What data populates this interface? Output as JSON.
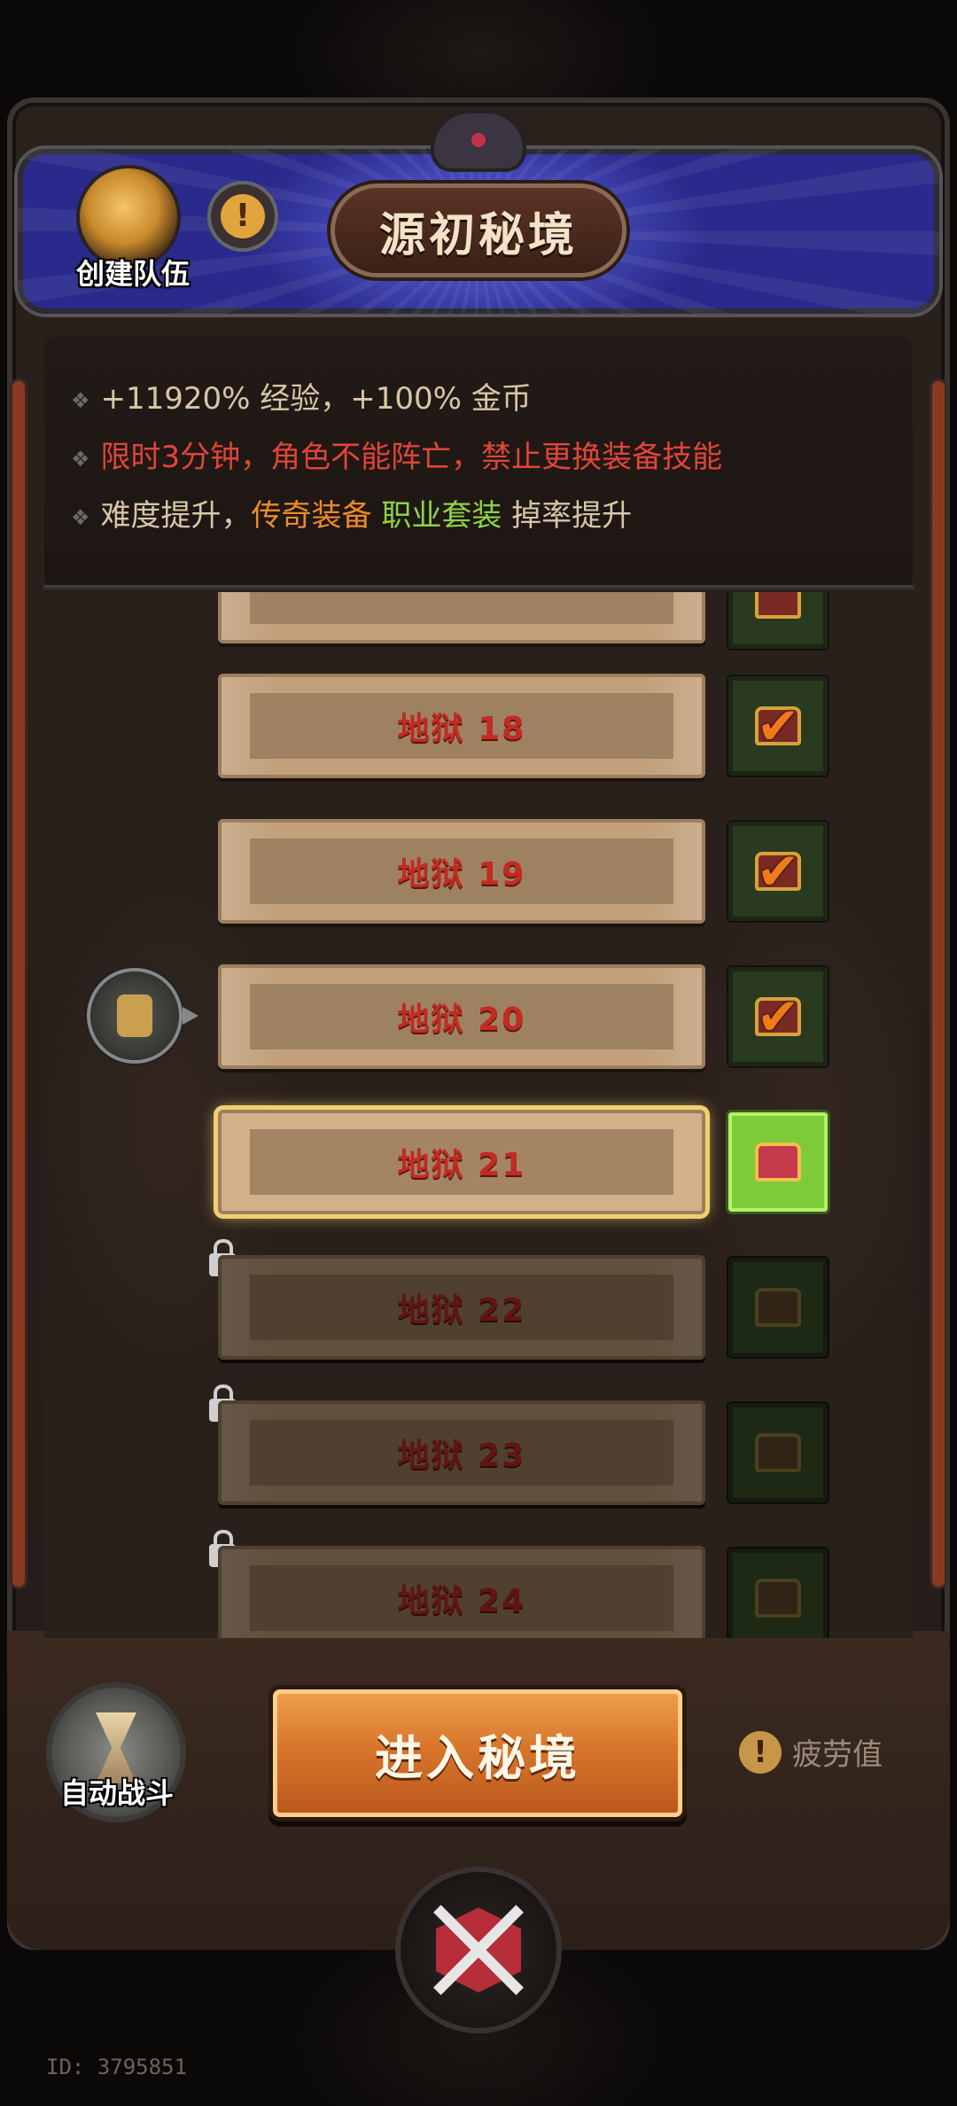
{
  "header": {
    "title": "源初秘境",
    "create_team_label": "创建队伍",
    "info_icon": "exclamation-icon"
  },
  "info": {
    "line1": "+11920% 经验，+100% 金币",
    "line2": "限时3分钟，角色不能阵亡，禁止更换装备技能",
    "line3_prefix": "难度提升，",
    "line3_legendary": "传奇装备",
    "line3_set": "职业套装",
    "line3_suffix": "掉率提升",
    "bullet": "❖"
  },
  "levels": [
    {
      "label": "地狱 18",
      "state": "completed"
    },
    {
      "label": "地狱 19",
      "state": "completed"
    },
    {
      "label": "地狱 20",
      "state": "completed"
    },
    {
      "label": "地狱 21",
      "state": "current"
    },
    {
      "label": "地狱 22",
      "state": "locked"
    },
    {
      "label": "地狱 23",
      "state": "locked"
    },
    {
      "label": "地狱 24",
      "state": "locked"
    }
  ],
  "check_glyph": "✔",
  "footer": {
    "auto_battle_label": "自动战斗",
    "enter_button_label": "进入秘境",
    "fatigue_label": "疲劳值",
    "fatigue_icon_glyph": "!",
    "user_id": "ID: 3795851"
  },
  "colors": {
    "accent_orange": "#d8762c",
    "level_text_red": "#c22a24",
    "completed_check": "#f07a1a",
    "current_chest_green": "#7ecb3a",
    "legendary_orange": "#ee8a2c",
    "set_green": "#8ed346",
    "warning_red": "#e0453a"
  }
}
